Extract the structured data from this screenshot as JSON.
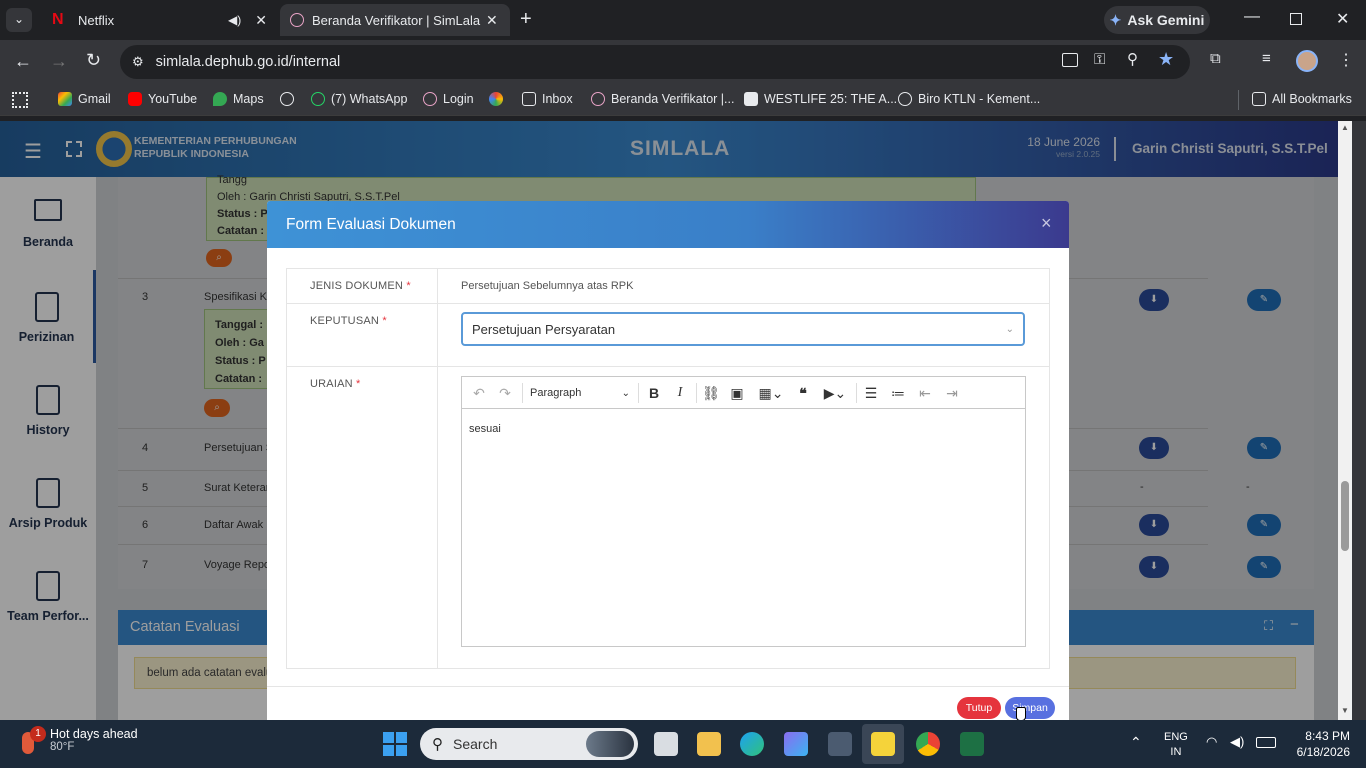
{
  "browser": {
    "tabs": [
      {
        "label": "Netflix",
        "active": false
      },
      {
        "label": "Beranda Verifikator | SimLala",
        "active": true
      }
    ],
    "url": "simlala.dephub.go.id/internal",
    "bookmarks": [
      {
        "label": "Gmail",
        "icon": "gmail-icon"
      },
      {
        "label": "YouTube",
        "icon": "youtube-icon"
      },
      {
        "label": "Maps",
        "icon": "maps-icon"
      },
      {
        "label": "(7) WhatsApp",
        "icon": "whatsapp-icon"
      },
      {
        "label": "Login",
        "icon": "globe-icon"
      },
      {
        "label": "Inbox",
        "icon": "inbox-icon"
      },
      {
        "label": "Beranda Verifikator |...",
        "icon": "globe-icon"
      },
      {
        "label": "WESTLIFE 25: THE A...",
        "icon": "l-icon"
      },
      {
        "label": "Biro KTLN - Kement...",
        "icon": "globe-icon"
      }
    ],
    "all_bookmarks": "All Bookmarks",
    "ask_gemini": "Ask Gemini"
  },
  "app": {
    "logo_line1": "KEMENTERIAN PERHUBUNGAN",
    "logo_line2": "REPUBLIK INDONESIA",
    "title": "SIMLALA",
    "date": "18 June 2026",
    "version": "versi 2.0.25",
    "user": "Garin Christi Saputri, S.S.T.Pel",
    "sidebar": [
      {
        "label": "Beranda"
      },
      {
        "label": "Perizinan"
      },
      {
        "label": "History"
      },
      {
        "label": "Arsip Produk"
      },
      {
        "label": "Team Perfor..."
      }
    ]
  },
  "background_table": {
    "history_block": {
      "oleh": "Oleh : Garin Christi Saputri, S.S.T.Pel",
      "status": "Status : P",
      "catatan": "Catatan :",
      "tanggal": "Tangg"
    },
    "rows": [
      {
        "no": "3",
        "name": "Spesifikasi Ka",
        "tanggal": "Tanggal :",
        "oleh": "Oleh : Ga",
        "status": "Status : P",
        "catatan": "Catatan :"
      },
      {
        "no": "4",
        "name": "Persetujuan S"
      },
      {
        "no": "5",
        "name": "Surat Keterar",
        "dash1": "-",
        "dash2": "-"
      },
      {
        "no": "6",
        "name": "Daftar Awak"
      },
      {
        "no": "7",
        "name": "Voyage Repo"
      }
    ],
    "catatan_title": "Catatan Evaluasi",
    "catatan_text": "belum ada catatan evalu"
  },
  "modal": {
    "title": "Form Evaluasi Dokumen",
    "close": "×",
    "jenis_label": "JENIS DOKUMEN",
    "jenis_value": "Persetujuan Sebelumnya atas RPK",
    "keputusan_label": "KEPUTUSAN",
    "keputusan_value": "Persetujuan Persyaratan",
    "uraian_label": "URAIAN",
    "required_mark": "*",
    "editor_format": "Paragraph",
    "editor_content": "sesuai",
    "btn_tutup": "Tutup",
    "btn_simpan": "Simpan"
  },
  "taskbar": {
    "weather_title": "Hot days ahead",
    "weather_temp": "80°F",
    "notif_count": "1",
    "search_placeholder": "Search",
    "lang1": "ENG",
    "lang2": "IN",
    "time": "8:43 PM",
    "date": "6/18/2026"
  }
}
